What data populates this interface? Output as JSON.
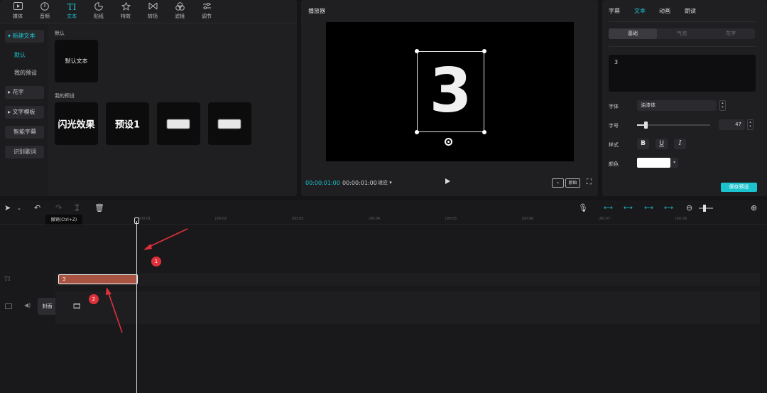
{
  "top_toolbar": {
    "tools": [
      {
        "label": "媒体",
        "icon": "media-icon"
      },
      {
        "label": "音频",
        "icon": "audio-icon"
      },
      {
        "label": "文本",
        "icon": "text-icon",
        "glyph": "TI",
        "active": true
      },
      {
        "label": "贴纸",
        "icon": "sticker-icon"
      },
      {
        "label": "特效",
        "icon": "effects-icon"
      },
      {
        "label": "转场",
        "icon": "transition-icon"
      },
      {
        "label": "滤镜",
        "icon": "filter-icon"
      },
      {
        "label": "调节",
        "icon": "adjust-icon"
      }
    ]
  },
  "sidebar": {
    "items": [
      {
        "label": "新建文本",
        "expanded": true
      },
      {
        "label": "默认",
        "selected": true
      },
      {
        "label": "我的预设"
      },
      {
        "label": "花字"
      },
      {
        "label": "文字模板"
      },
      {
        "label": "智能字幕"
      },
      {
        "label": "识别歌词"
      }
    ]
  },
  "text_library": {
    "default_section": "默认",
    "default_card": "默认文本",
    "preset_section": "我的预设",
    "presets": [
      "闪光效果",
      "预设1"
    ]
  },
  "player": {
    "title": "播放器",
    "preview_text": "3",
    "current_time": "00:00:01:00",
    "total_time": "00:00:01:00",
    "ratio_label": "适应",
    "original_label": "原始"
  },
  "inspector": {
    "tabs": [
      "字幕",
      "文本",
      "动画",
      "朗读"
    ],
    "active_tab": "文本",
    "segments": [
      "基础",
      "气泡",
      "花字"
    ],
    "text_value": "3",
    "font_label": "字体",
    "font_value": "油漆体",
    "size_label": "字号",
    "size_value": "47",
    "size_fraction": 0.12,
    "style_label": "样式",
    "style_buttons": [
      "B",
      "U",
      "I"
    ],
    "color_label": "颜色",
    "color_value": "#ffffff",
    "save_preset": "保存预设"
  },
  "timeline": {
    "tooltip": "撤销(Ctrl+Z)",
    "ruler": [
      "|00:01",
      "|00:02",
      "|00:03",
      "|00:04",
      "|00:05",
      "|00:06",
      "|00:07",
      "|00:08"
    ],
    "text_clip": "3",
    "cover_label": "封面",
    "text_track_icon": "TI",
    "annotations": [
      "1",
      "2"
    ]
  },
  "colors": {
    "accent": "#1bc3cf",
    "clip": "#a95443",
    "annotation": "#e0303a"
  }
}
